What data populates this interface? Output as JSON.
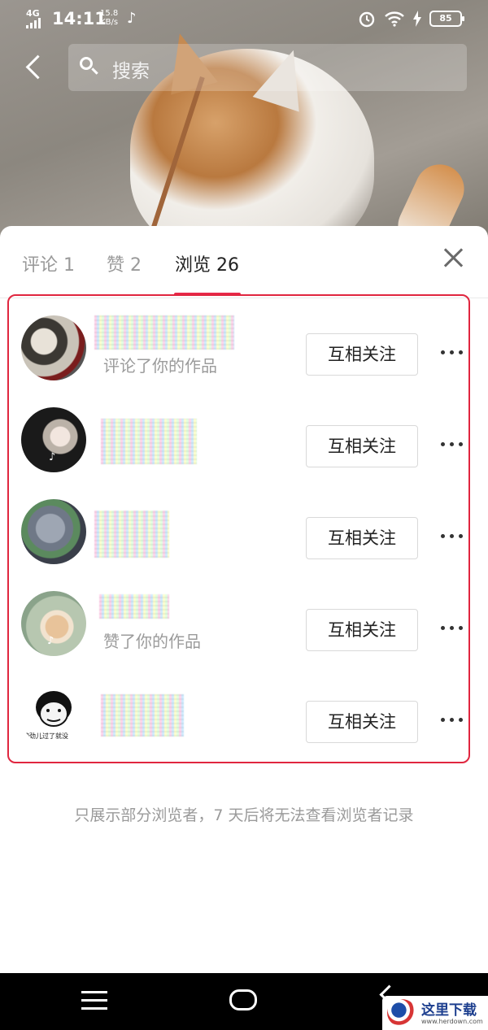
{
  "status_bar": {
    "network": "4G",
    "time": "14:11",
    "speed_value": "15.8",
    "speed_unit": "KB/s",
    "battery": "85"
  },
  "search": {
    "placeholder": "搜索"
  },
  "tabs": [
    {
      "label": "评论 1",
      "active": false
    },
    {
      "label": "赞 2",
      "active": false
    },
    {
      "label": "浏览 26",
      "active": true
    }
  ],
  "viewers": [
    {
      "subtitle": "评论了你的作品",
      "button": "互相关注"
    },
    {
      "subtitle": "",
      "button": "互相关注"
    },
    {
      "subtitle": "",
      "button": "互相关注"
    },
    {
      "subtitle": "赞了你的作品",
      "button": "互相关注"
    },
    {
      "subtitle": "",
      "button": "互相关注"
    }
  ],
  "avatar_captions": {
    "last": "使劲儿过了就没"
  },
  "footer_note": "只展示部分浏览者，7 天后将无法查看浏览者记录",
  "watermark": {
    "text": "这里下载",
    "url": "www.herdown.com"
  },
  "colors": {
    "accent": "#e8294a",
    "frame": "#e0263f"
  }
}
